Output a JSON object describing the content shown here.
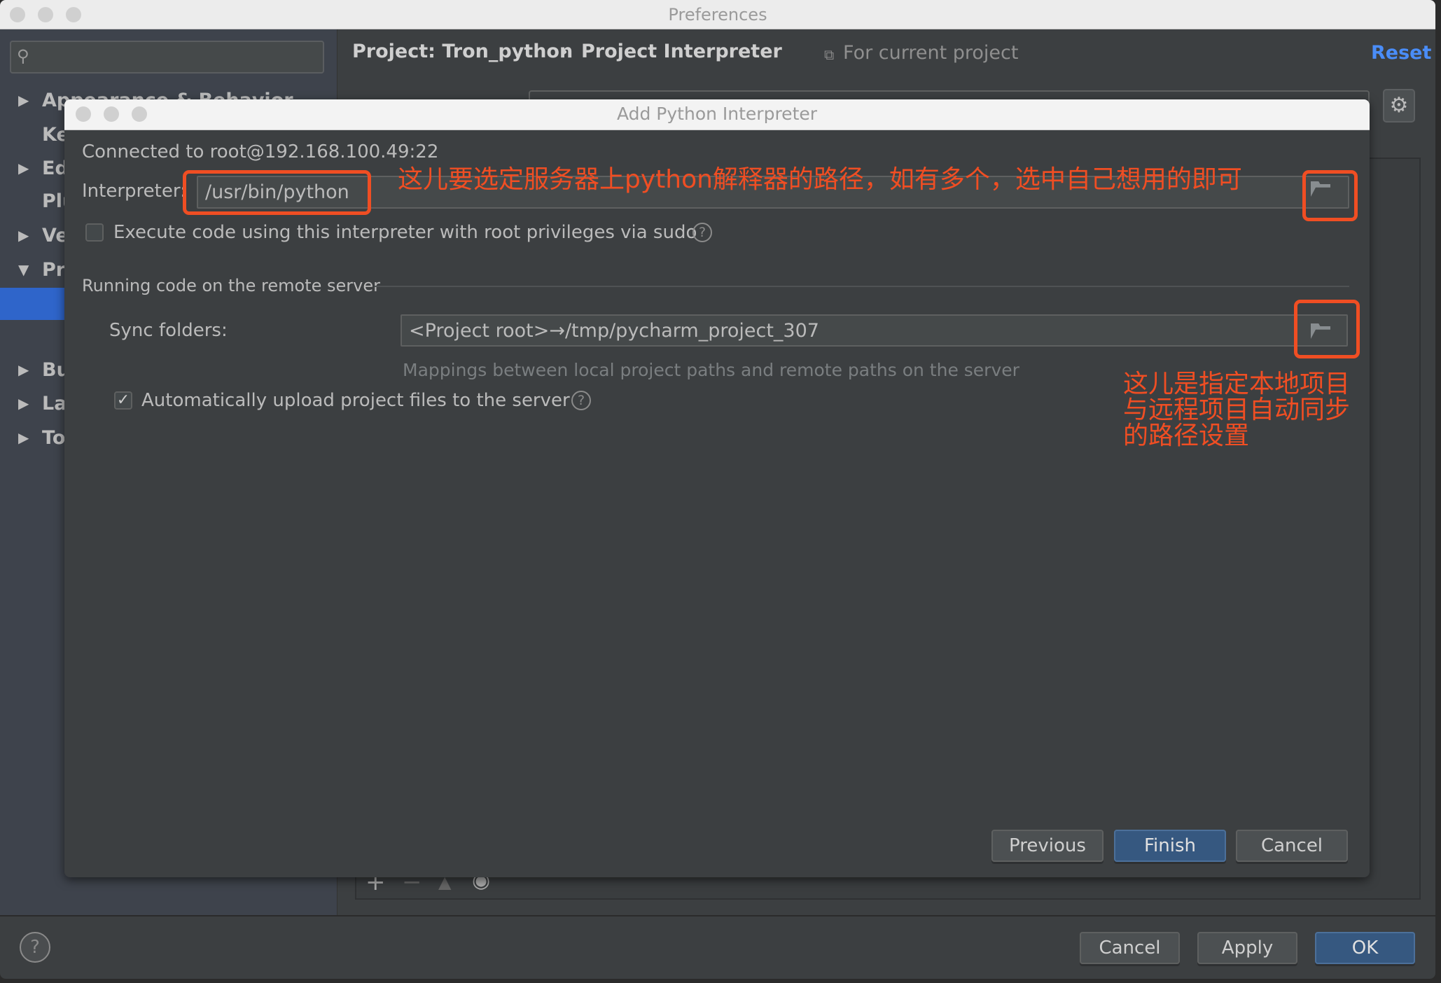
{
  "window": {
    "title": "Preferences"
  },
  "sidebar": {
    "search_placeholder": "",
    "items": [
      {
        "label": "Appearance & Behavior",
        "arrow": "▶"
      },
      {
        "label": "Ke",
        "arrow": ""
      },
      {
        "label": "Ed",
        "arrow": "▶"
      },
      {
        "label": "Plu",
        "arrow": ""
      },
      {
        "label": "Ve",
        "arrow": "▶"
      },
      {
        "label": "Pr",
        "arrow": "▼"
      },
      {
        "label": "",
        "arrow": "",
        "selected": true
      },
      {
        "label": "Bu",
        "arrow": "▶"
      },
      {
        "label": "La",
        "arrow": "▶"
      },
      {
        "label": "To",
        "arrow": "▶"
      }
    ]
  },
  "header": {
    "breadcrumb_project": "Project: Tron_python",
    "breadcrumb_sep": "›",
    "breadcrumb_page": "Project Interpreter",
    "scope": "For current project",
    "reset": "Reset"
  },
  "dialog": {
    "title": "Add Python Interpreter",
    "connected": "Connected to root@192.168.100.49:22",
    "interpreter_label": "Interpreter:",
    "interpreter_value": "/usr/bin/python",
    "sudo_label": "Execute code using this interpreter with root privileges via sudo",
    "sudo_checked": false,
    "section": "Running code on the remote server",
    "sync_label": "Sync folders:",
    "sync_value": "<Project root>→/tmp/pycharm_project_307",
    "sync_hint": "Mappings between local project paths and remote paths on the server",
    "upload_label": "Automatically upload project files to the server",
    "upload_checked": true,
    "previous": "Previous",
    "finish": "Finish",
    "cancel": "Cancel"
  },
  "annotations": {
    "interpreter_note": "这儿要选定服务器上python解释器的路径，如有多个，选中自己想用的即可",
    "sync_note": [
      "这儿是指定本地项目",
      "与远程项目自动同步",
      "的路径设置"
    ],
    "color": "#f04e23"
  },
  "footer": {
    "help": "?",
    "cancel": "Cancel",
    "apply": "Apply",
    "ok": "OK"
  },
  "colors": {
    "accent": "#2f65ca",
    "primary_button": "#365880",
    "link": "#4a8df8"
  }
}
